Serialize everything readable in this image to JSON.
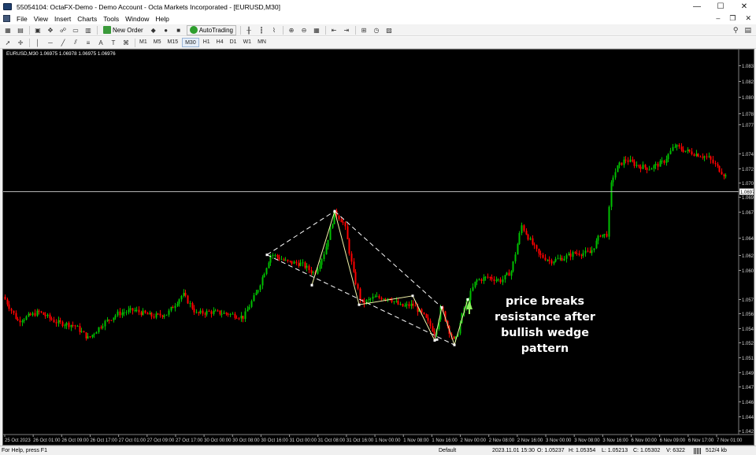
{
  "window": {
    "title": "55054104: OctaFX-Demo - Demo Account - Octa Markets Incorporated - [EURUSD,M30]",
    "minimize": "—",
    "maximize": "☐",
    "close": "✕"
  },
  "menu": {
    "items": [
      "File",
      "View",
      "Insert",
      "Charts",
      "Tools",
      "Window",
      "Help"
    ],
    "doc_min": "–",
    "doc_restore": "❐",
    "doc_close": "✕"
  },
  "toolbar": {
    "new_order": "New Order",
    "autotrading": "AutoTrading",
    "timeframes": [
      "M1",
      "M5",
      "M15",
      "M30",
      "H1",
      "H4",
      "D1",
      "W1",
      "MN"
    ],
    "active_timeframe": "M30",
    "icons": [
      "new-chart-icon",
      "profiles-icon",
      "market-watch-icon",
      "navigator-icon",
      "data-window-icon",
      "terminal-icon",
      "strategy-tester-icon",
      "options-icon",
      "cursor-icon",
      "crosshair-icon",
      "vertical-line-icon",
      "horizontal-line-icon",
      "trendline-icon",
      "channel-icon",
      "fibonacci-icon",
      "text-icon",
      "label-icon",
      "shapes-icon",
      "bar-chart-icon",
      "candlestick-icon",
      "line-chart-icon",
      "zoom-in-icon",
      "zoom-out-icon",
      "tile-windows-icon",
      "chart-shift-icon",
      "autoscroll-icon",
      "indicators-icon",
      "periods-icon",
      "templates-icon",
      "search-icon",
      "chat-icon"
    ]
  },
  "chart": {
    "symbol_label": "EURUSD,M30  1.06975 1.06978 1.06975 1.06976",
    "current_price": "1.06976",
    "annotation": [
      "price breaks",
      "resistance after",
      "bullish wedge",
      "pattern"
    ],
    "colors": {
      "background": "#000000",
      "bull": "#00c000",
      "bear": "#ff0000",
      "wedge": "#ffffff",
      "arrow": "#90ee60"
    }
  },
  "chart_data": {
    "type": "candlestick",
    "symbol": "EURUSD",
    "timeframe": "M30",
    "ylim": [
      1.04245,
      1.08455
    ],
    "y_ticks": [
      "1.08380",
      "1.08205",
      "1.08030",
      "1.07850",
      "1.07725",
      "1.07400",
      "1.07225",
      "1.07070",
      "1.06910",
      "1.06745",
      "1.06450",
      "1.06255",
      "1.06090",
      "1.05765",
      "1.05600",
      "1.05435",
      "1.05275",
      "1.05110",
      "1.04945",
      "1.04780",
      "1.04615",
      "1.04450",
      "1.04290"
    ],
    "x_ticks": [
      "25 Oct 2023",
      "26 Oct 01:00",
      "26 Oct 09:00",
      "26 Oct 17:00",
      "27 Oct 01:00",
      "27 Oct 09:00",
      "27 Oct 17:00",
      "30 Oct 00:00",
      "30 Oct 08:00",
      "30 Oct 16:00",
      "31 Oct 00:00",
      "31 Oct 08:00",
      "31 Oct 16:00",
      "1 Nov 00:00",
      "1 Nov 08:00",
      "1 Nov 16:00",
      "2 Nov 00:00",
      "2 Nov 08:00",
      "2 Nov 16:00",
      "3 Nov 00:00",
      "3 Nov 08:00",
      "3 Nov 16:00",
      "6 Nov 00:00",
      "6 Nov 09:00",
      "6 Nov 17:00",
      "7 Nov 01:00"
    ],
    "current_price": 1.06976,
    "price_path": [
      [
        0,
        1.0579
      ],
      [
        18,
        1.0552
      ],
      [
        45,
        1.0562
      ],
      [
        68,
        1.055
      ],
      [
        90,
        1.0547
      ],
      [
        108,
        1.0532
      ],
      [
        125,
        1.0548
      ],
      [
        145,
        1.056
      ],
      [
        165,
        1.0564
      ],
      [
        190,
        1.0557
      ],
      [
        208,
        1.056
      ],
      [
        228,
        1.0582
      ],
      [
        245,
        1.056
      ],
      [
        262,
        1.0562
      ],
      [
        285,
        1.056
      ],
      [
        305,
        1.0556
      ],
      [
        322,
        1.0585
      ],
      [
        340,
        1.0627
      ],
      [
        360,
        1.0618
      ],
      [
        378,
        1.0616
      ],
      [
        395,
        1.0605
      ],
      [
        408,
        1.063
      ],
      [
        421,
        1.0674
      ],
      [
        433,
        1.066
      ],
      [
        445,
        1.0603
      ],
      [
        455,
        1.0571
      ],
      [
        470,
        1.0578
      ],
      [
        490,
        1.0578
      ],
      [
        505,
        1.0568
      ],
      [
        520,
        1.057
      ],
      [
        535,
        1.0556
      ],
      [
        548,
        1.0538
      ],
      [
        556,
        1.0567
      ],
      [
        565,
        1.0543
      ],
      [
        573,
        1.0527
      ],
      [
        585,
        1.0566
      ],
      [
        600,
        1.0597
      ],
      [
        615,
        1.0601
      ],
      [
        632,
        1.0597
      ],
      [
        645,
        1.0608
      ],
      [
        658,
        1.0659
      ],
      [
        668,
        1.0643
      ],
      [
        680,
        1.0626
      ],
      [
        695,
        1.0619
      ],
      [
        712,
        1.0623
      ],
      [
        725,
        1.0628
      ],
      [
        745,
        1.0628
      ],
      [
        758,
        1.0649
      ],
      [
        766,
        1.0648
      ],
      [
        772,
        1.071
      ],
      [
        780,
        1.0725
      ],
      [
        790,
        1.0733
      ],
      [
        805,
        1.0726
      ],
      [
        820,
        1.0723
      ],
      [
        838,
        1.073
      ],
      [
        852,
        1.0748
      ],
      [
        865,
        1.0743
      ],
      [
        880,
        1.0739
      ],
      [
        895,
        1.0735
      ],
      [
        915,
        1.0716
      ],
      [
        932,
        1.0702
      ]
    ]
  }
}
